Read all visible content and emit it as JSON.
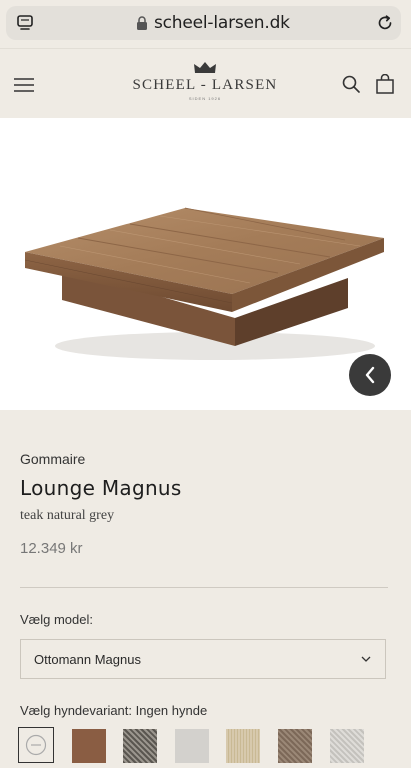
{
  "browser": {
    "url": "scheel-larsen.dk"
  },
  "header": {
    "logo_text": "SCHEEL - LARSEN",
    "logo_sub": "SIDEN 1926"
  },
  "product": {
    "brand": "Gommaire",
    "title": "Lounge Magnus",
    "variant": "teak natural grey",
    "price": "12.349 kr"
  },
  "model": {
    "label": "Vælg model:",
    "selected": "Ottomann Magnus"
  },
  "cushion": {
    "label": "Vælg hyndevariant: Ingen hynde",
    "swatches": [
      {
        "name": "none",
        "color": "#efebe4"
      },
      {
        "name": "brown",
        "color": "#8a5d43"
      },
      {
        "name": "charcoal-tweed",
        "color": "#6f6a63"
      },
      {
        "name": "light-grey",
        "color": "#d3d1cd"
      },
      {
        "name": "beige",
        "color": "#d7c9ad"
      },
      {
        "name": "taupe",
        "color": "#8b7766"
      },
      {
        "name": "pale-grey",
        "color": "#cfcdc8"
      }
    ]
  }
}
